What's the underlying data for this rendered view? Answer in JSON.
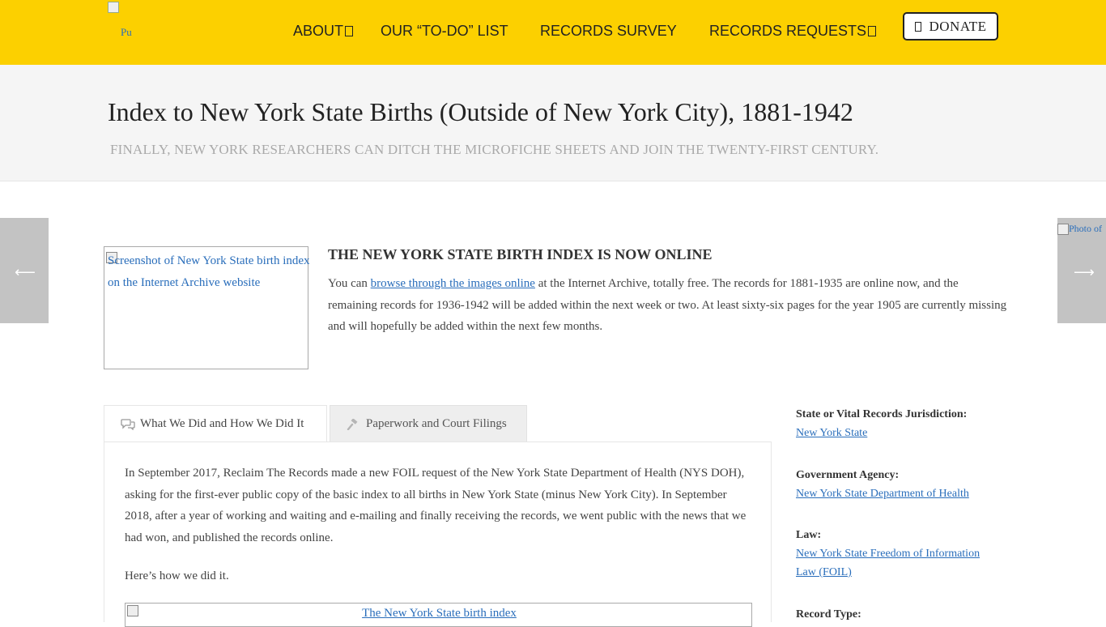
{
  "header": {
    "logo_alt": "Pu",
    "nav": [
      {
        "label": "ABOUT",
        "has_dropdown": true
      },
      {
        "label": "OUR “TO-DO” LIST",
        "has_dropdown": false
      },
      {
        "label": "RECORDS SURVEY",
        "has_dropdown": false
      },
      {
        "label": "RECORDS REQUESTS",
        "has_dropdown": true
      }
    ],
    "donate_label": "DONATE"
  },
  "page": {
    "title": "Index to New York State Births (Outside of New York City), 1881-1942",
    "subtitle": "FINALLY, NEW YORK RESEARCHERS CAN DITCH THE MICROFICHE SHEETS AND JOIN THE TWENTY-FIRST CENTURY."
  },
  "side_nav": {
    "next_thumb_alt": "Photo of"
  },
  "featured": {
    "image_alt": "Screenshot of New York State birth index on the Internet Archive website",
    "heading": "THE NEW YORK STATE BIRTH INDEX IS NOW ONLINE",
    "text_before_link": "You can ",
    "link_text": "browse through the images online",
    "text_after_link": " at the Internet Archive, totally free. The records for 1881-1935 are online now, and the remaining records for 1936-1942 will be added within the next week or two. At least sixty-six pages for the year 1905 are currently missing and will hopefully be added within the next few months."
  },
  "tabs": [
    {
      "label": "What We Did and How We Did It",
      "icon": "comments-icon",
      "active": true
    },
    {
      "label": "Paperwork and Court Filings",
      "icon": "gavel-icon",
      "active": false
    }
  ],
  "panel": {
    "paragraph1": "In September 2017, Reclaim The Records made a new FOIL request of the New York State Department of Health (NYS DOH), asking for the first-ever public copy of the basic index to all births in New York State (minus New York City). In September 2018, after a year of working and waiting and e-mailing and finally receiving the records, we went public with the news that we had won, and published the records online.",
    "paragraph2": "Here’s how we did it.",
    "image_alt": "The New York State birth index"
  },
  "sidebar": [
    {
      "label": "State or Vital Records Jurisdiction:",
      "values": [
        "New York State"
      ]
    },
    {
      "label": "Government Agency:",
      "values": [
        "New York State Department of Health"
      ]
    },
    {
      "label": "Law:",
      "values": [
        "New York State Freedom of Information Law (FOIL)"
      ]
    },
    {
      "label": "Record Type:",
      "values": []
    }
  ],
  "colors": {
    "header_bg": "#fcd000",
    "title_band_bg": "#f5f5f5",
    "link": "#2a6ebb"
  }
}
